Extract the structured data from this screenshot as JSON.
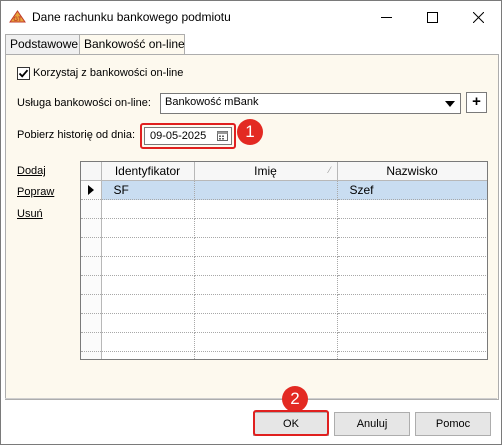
{
  "window": {
    "title": "Dane rachunku bankowego podmiotu"
  },
  "tabs": [
    {
      "label": "Podstawowe"
    },
    {
      "label": "Bankowość on-line"
    }
  ],
  "form": {
    "use_online_label": "Korzystaj z bankowości on-line",
    "service_label": "Usługa bankowości on-line:",
    "service_value": "Bankowość mBank",
    "add_button_label": "+",
    "history_label": "Pobierz historię od dnia:",
    "history_date": "09-05-2025"
  },
  "side_links": [
    {
      "label": "Dodaj"
    },
    {
      "label": "Popraw"
    },
    {
      "label": "Usuń"
    }
  ],
  "grid": {
    "columns": [
      "Identyfikator",
      "Imię",
      "Nazwisko"
    ],
    "rows": [
      {
        "identyfikator": "SF",
        "imie": "",
        "nazwisko": "Szef"
      }
    ]
  },
  "annotations": [
    {
      "label": "1"
    },
    {
      "label": "2"
    }
  ],
  "buttons": {
    "ok": "OK",
    "cancel": "Anuluj",
    "help": "Pomoc"
  },
  "colors": {
    "accent_red": "#e32a22",
    "selected_row": "#c9ddf1",
    "panel_bg": "#fdf9ee"
  }
}
